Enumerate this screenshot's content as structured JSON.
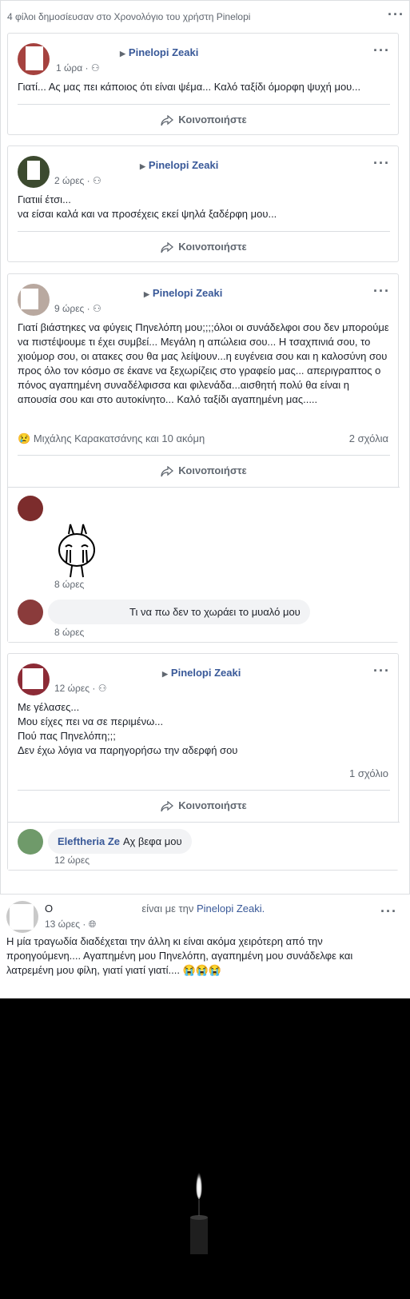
{
  "group_header": {
    "text": "4 φίλοι δημοσίευσαν στο Χρονολόγιο του χρήστη Pinelopi"
  },
  "posts": [
    {
      "target_name": "Pinelopi Zeaki",
      "time": "1 ώρα",
      "body": "Γιατί... Ας μας πει κάποιος ότι είναι ψέμα... Καλό ταξίδι όμορφη ψυχή μου...",
      "share_label": "Κοινοποιήστε"
    },
    {
      "target_name": "Pinelopi Zeaki",
      "time": "2 ώρες",
      "body_lines": [
        "Γιατιιί έτσι...",
        "να είσαι καλά και να προσέχεις εκεί ψηλά ξαδέρφη μου..."
      ],
      "share_label": "Κοινοποιήστε"
    },
    {
      "target_name": "Pinelopi Zeaki",
      "time": "9 ώρες",
      "body": "Γιατί βιάστηκες να φύγεις Πηνελόπη μου;;;;όλοι οι συνάδελφοι σου δεν μπορούμε να πιστέψουμε τι έχει συμβεί... Μεγάλη η απώλεια σου... Η τσαχπινιά σου, το χιούμορ σου, οι ατακες σου θα μας λείψουν...η ευγένεια σου και η καλοσύνη σου προς όλο τον κόσμο σε έκανε να ξεχωρίζεις στο γραφείο μας... απεριγραπτος ο πόνος αγαπημένη συναδέλφισσα και φιλενάδα...αισθητή πολύ θα είναι η απουσία σου και στο αυτοκίνητο... Καλό ταξίδι αγαπημένη μας.....",
      "reactions": "Μιχάλης Καρακατσάνης και 10 ακόμη",
      "comments_count": "2 σχόλια",
      "share_label": "Κοινοποιήστε",
      "comments": [
        {
          "time": "8 ώρες"
        },
        {
          "text": "Τι να πω δεν το χωράει το μυαλό μου",
          "time": "8 ώρες"
        }
      ]
    },
    {
      "target_name": "Pinelopi Zeaki",
      "time": "12 ώρες",
      "body_lines": [
        "Με γέλασες...",
        "Μου είχες πει να σε περιμένω...",
        "Πού πας Πηνελόπη;;;",
        "Δεν έχω λόγια να παρηγορήσω την αδερφή σου"
      ],
      "comments_count": "1 σχόλιο",
      "share_label": "Κοινοποιήστε",
      "comments": [
        {
          "author": "Eleftheria Ze",
          "text": "Αχ βεφα μου",
          "time": "12 ώρες"
        }
      ]
    }
  ],
  "post2": {
    "author_initial": "Ο",
    "with_text": "είναι με την",
    "tagged": "Pinelopi Zeaki.",
    "time": "13 ώρες",
    "body": "Η μία τραγωδία διαδέχεται την άλλη κι είναι ακόμα χειρότερη από την προηγούμενη.... Αγαπημένη μου Πηνελόπη, αγαπημένη μου συνάδελφε και λατρεμένη μου φίλη, γιατί γιατί γιατί.... 😭😭😭"
  },
  "colors": {
    "link": "#385898",
    "meta": "#606770",
    "bg": "#e9ebee"
  }
}
